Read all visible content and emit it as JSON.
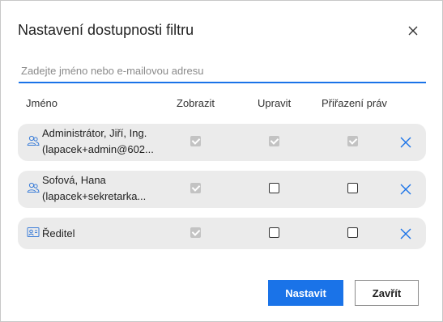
{
  "dialog": {
    "title": "Nastavení dostupnosti filtru",
    "close_icon": "close-icon"
  },
  "search": {
    "placeholder": "Zadejte jméno nebo e-mailovou adresu",
    "value": ""
  },
  "table": {
    "headers": {
      "name": "Jméno",
      "show": "Zobrazit",
      "edit": "Upravit",
      "rights": "Přiřazení práv"
    },
    "rows": [
      {
        "icon": "users-group-icon",
        "line1": "Administrátor, Jiří, Ing.",
        "line2": "(lapacek+admin@602...",
        "show": true,
        "show_enabled": false,
        "edit": true,
        "edit_enabled": false,
        "rights": true,
        "rights_enabled": false
      },
      {
        "icon": "users-group-icon",
        "line1": "Sofová, Hana",
        "line2": "(lapacek+sekretarka...",
        "show": true,
        "show_enabled": false,
        "edit": false,
        "edit_enabled": true,
        "rights": false,
        "rights_enabled": true
      },
      {
        "icon": "id-card-icon",
        "line1": "Ředitel",
        "line2": "",
        "show": true,
        "show_enabled": false,
        "edit": false,
        "edit_enabled": true,
        "rights": false,
        "rights_enabled": true
      }
    ]
  },
  "footer": {
    "primary_label": "Nastavit",
    "secondary_label": "Zavřít"
  },
  "colors": {
    "accent": "#1a73e8",
    "row_background": "#ebebeb",
    "disabled_checkbox": "#c3c3c3"
  }
}
